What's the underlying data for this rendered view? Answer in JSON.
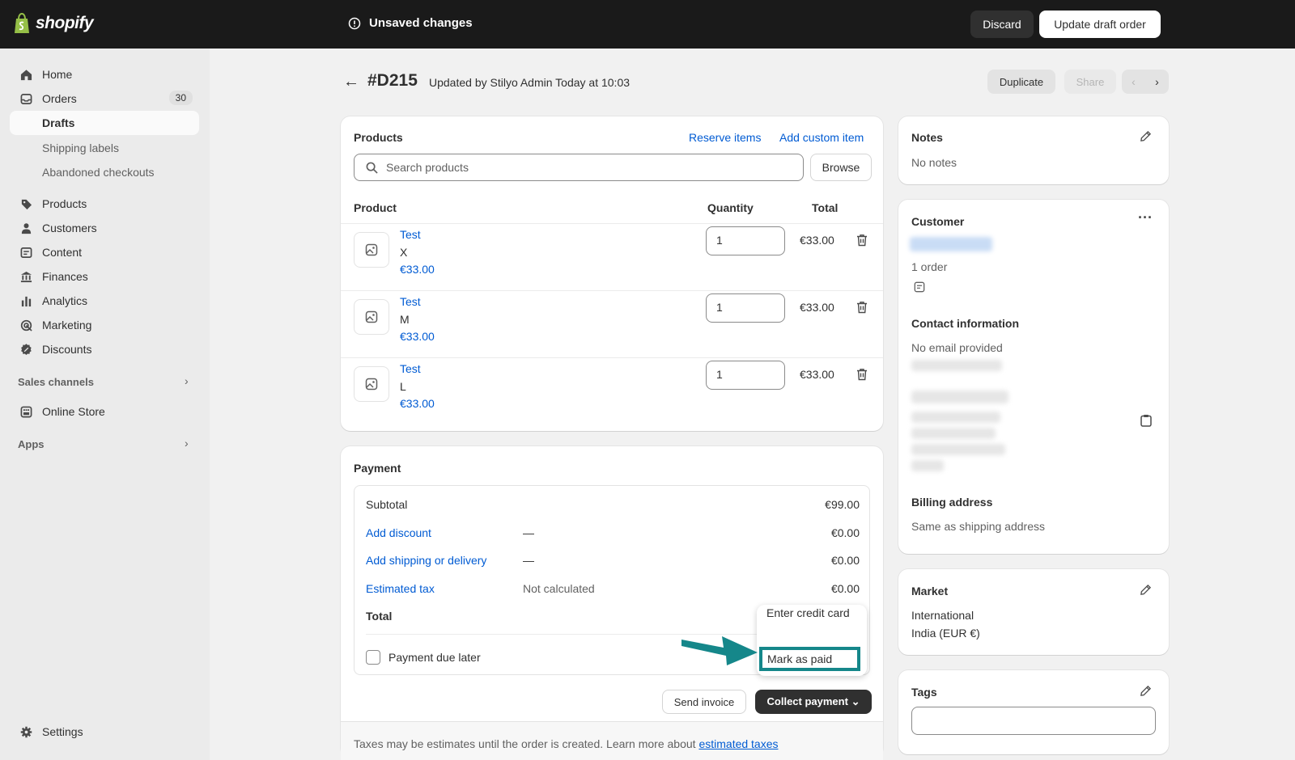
{
  "topbar": {
    "logo_text": "shopify",
    "unsaved_label": "Unsaved changes",
    "discard_label": "Discard",
    "update_label": "Update draft order"
  },
  "sidebar": {
    "items": [
      {
        "label": "Home",
        "icon": "home-icon"
      },
      {
        "label": "Orders",
        "icon": "inbox-icon",
        "badge": "30"
      },
      {
        "label": "Drafts"
      },
      {
        "label": "Shipping labels"
      },
      {
        "label": "Abandoned checkouts"
      },
      {
        "label": "Products",
        "icon": "tag-icon"
      },
      {
        "label": "Customers",
        "icon": "person-icon"
      },
      {
        "label": "Content",
        "icon": "content-icon"
      },
      {
        "label": "Finances",
        "icon": "bank-icon"
      },
      {
        "label": "Analytics",
        "icon": "bar-chart-icon"
      },
      {
        "label": "Marketing",
        "icon": "target-icon"
      },
      {
        "label": "Discounts",
        "icon": "discount-icon"
      }
    ],
    "sales_channels_label": "Sales channels",
    "online_store_label": "Online Store",
    "apps_label": "Apps",
    "settings_label": "Settings"
  },
  "header": {
    "order_id": "#D215",
    "subtitle": "Updated by Stilyo Admin Today at 10:03",
    "duplicate_label": "Duplicate",
    "share_label": "Share"
  },
  "products": {
    "title": "Products",
    "reserve_label": "Reserve items",
    "custom_label": "Add custom item",
    "search_placeholder": "Search products",
    "browse_label": "Browse",
    "col_product": "Product",
    "col_quantity": "Quantity",
    "col_total": "Total",
    "rows": [
      {
        "name": "Test",
        "variant": "X",
        "price": "€33.00",
        "qty": "1",
        "total": "€33.00"
      },
      {
        "name": "Test",
        "variant": "M",
        "price": "€33.00",
        "qty": "1",
        "total": "€33.00"
      },
      {
        "name": "Test",
        "variant": "L",
        "price": "€33.00",
        "qty": "1",
        "total": "€33.00"
      }
    ]
  },
  "payment": {
    "title": "Payment",
    "subtotal_label": "Subtotal",
    "subtotal_value": "€99.00",
    "discount_label": "Add discount",
    "discount_mid": "—",
    "discount_value": "€0.00",
    "shipping_label": "Add shipping or delivery",
    "shipping_mid": "—",
    "shipping_value": "€0.00",
    "tax_label": "Estimated tax",
    "tax_mid": "Not calculated",
    "tax_value": "€0.00",
    "total_label": "Total",
    "due_later_label": "Payment due later",
    "send_invoice_label": "Send invoice",
    "collect_label": "Collect payment",
    "footer_text": "Taxes may be estimates until the order is created. Learn more about ",
    "footer_link": "estimated taxes",
    "menu": {
      "enter_card": "Enter credit card",
      "mark_paid": "Mark as paid"
    }
  },
  "notes": {
    "title": "Notes",
    "empty": "No notes"
  },
  "customer": {
    "title": "Customer",
    "orders": "1 order",
    "contact_title": "Contact information",
    "no_email": "No email provided",
    "billing_title": "Billing address",
    "billing_value": "Same as shipping address"
  },
  "market": {
    "title": "Market",
    "name": "International",
    "detail": "India (EUR €)"
  },
  "tags": {
    "title": "Tags"
  },
  "colors": {
    "accent": "#005bd3",
    "topbar": "#1a1a1a",
    "highlight": "#15878a"
  }
}
